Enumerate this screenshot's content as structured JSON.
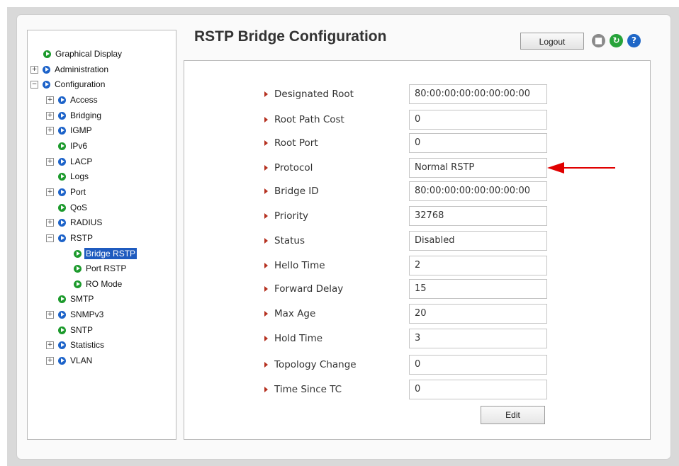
{
  "header": {
    "title": "RSTP Bridge Configuration",
    "logout_label": "Logout",
    "icons": [
      "save-icon",
      "refresh-icon",
      "help-icon"
    ]
  },
  "nav": [
    {
      "label": "Graphical Display",
      "expander": "",
      "icon": "green"
    },
    {
      "label": "Administration",
      "expander": "+",
      "icon": "blue"
    },
    {
      "label": "Configuration",
      "expander": "−",
      "icon": "blue"
    },
    {
      "label": "Access",
      "expander": "+",
      "icon": "blue"
    },
    {
      "label": "Bridging",
      "expander": "+",
      "icon": "blue"
    },
    {
      "label": "IGMP",
      "expander": "+",
      "icon": "blue"
    },
    {
      "label": "IPv6",
      "expander": "",
      "icon": "green"
    },
    {
      "label": "LACP",
      "expander": "+",
      "icon": "blue"
    },
    {
      "label": "Logs",
      "expander": "",
      "icon": "green"
    },
    {
      "label": "Port",
      "expander": "+",
      "icon": "blue"
    },
    {
      "label": "QoS",
      "expander": "",
      "icon": "green"
    },
    {
      "label": "RADIUS",
      "expander": "+",
      "icon": "blue"
    },
    {
      "label": "RSTP",
      "expander": "−",
      "icon": "blue"
    },
    {
      "label": "Bridge RSTP",
      "expander": "",
      "icon": "green",
      "selected": true
    },
    {
      "label": "Port RSTP",
      "expander": "",
      "icon": "green"
    },
    {
      "label": "RO Mode",
      "expander": "",
      "icon": "green"
    },
    {
      "label": "SMTP",
      "expander": "",
      "icon": "green"
    },
    {
      "label": "SNMPv3",
      "expander": "+",
      "icon": "blue"
    },
    {
      "label": "SNTP",
      "expander": "",
      "icon": "green"
    },
    {
      "label": "Statistics",
      "expander": "+",
      "icon": "blue"
    },
    {
      "label": "VLAN",
      "expander": "+",
      "icon": "blue"
    }
  ],
  "fields": [
    {
      "label": "Designated Root",
      "value": "80:00:00:00:00:00:00:00"
    },
    {
      "label": "Root Path Cost",
      "value": "0"
    },
    {
      "label": "Root Port",
      "value": "0"
    },
    {
      "label": "Protocol",
      "value": "Normal RSTP"
    },
    {
      "label": "Bridge ID",
      "value": "80:00:00:00:00:00:00:00"
    },
    {
      "label": "Priority",
      "value": "32768"
    },
    {
      "label": "Status",
      "value": "Disabled"
    },
    {
      "label": "Hello Time",
      "value": "2"
    },
    {
      "label": "Forward Delay",
      "value": "15"
    },
    {
      "label": "Max Age",
      "value": "20"
    },
    {
      "label": "Hold Time",
      "value": "3"
    },
    {
      "label": "Topology Change",
      "value": "0"
    },
    {
      "label": "Time Since TC",
      "value": "0"
    }
  ],
  "edit_label": "Edit",
  "colors": {
    "selected": "#1f5bbf",
    "arrow": "#e00000",
    "bullet": "#b5301f"
  }
}
